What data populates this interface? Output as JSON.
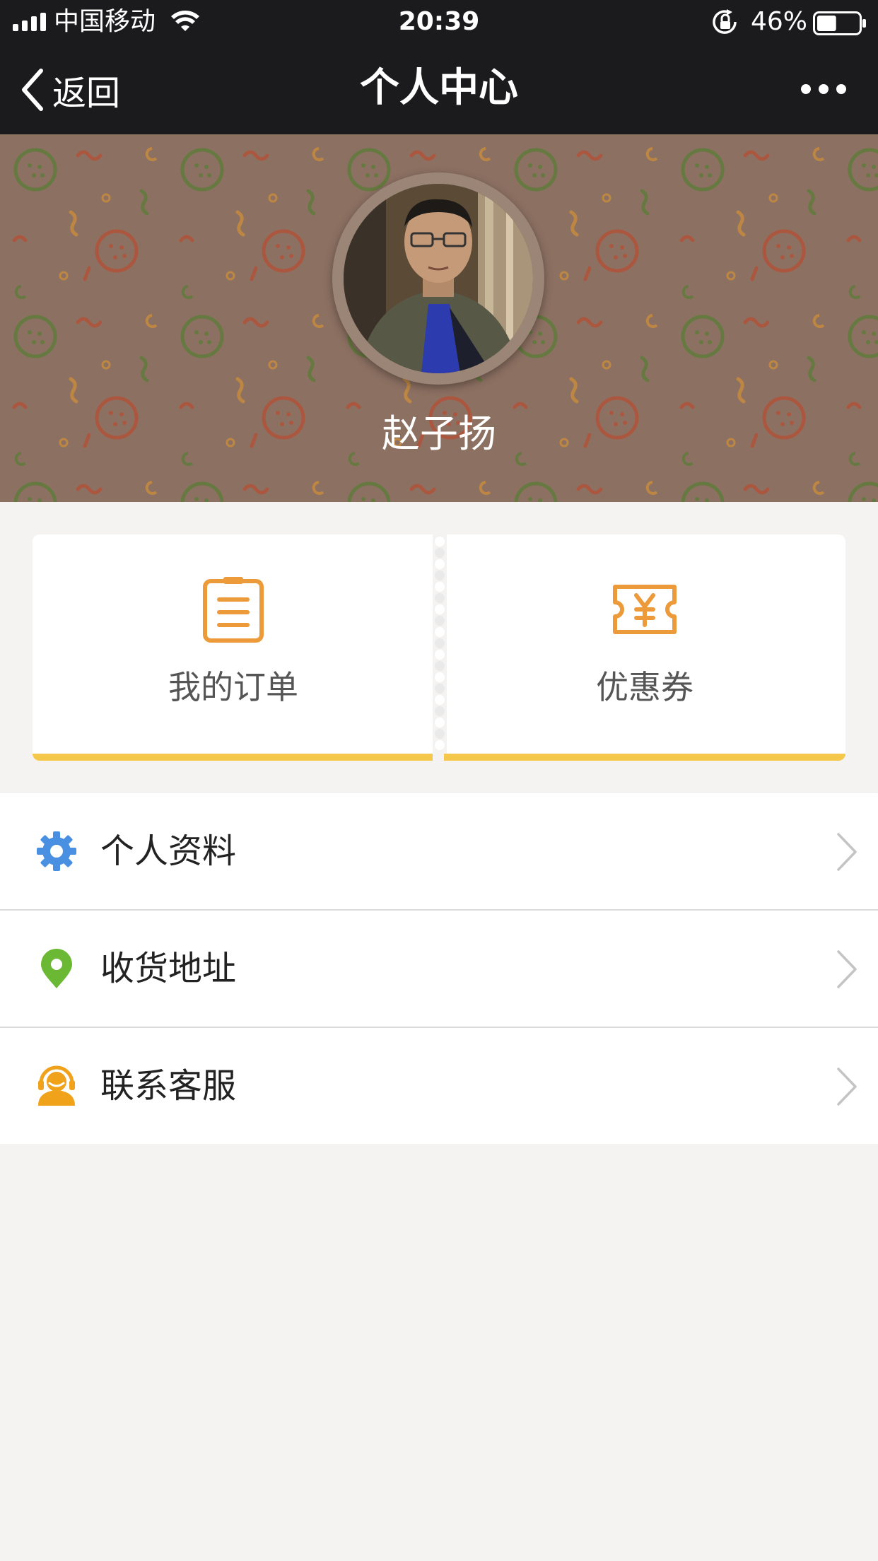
{
  "status_bar": {
    "carrier": "中国移动",
    "time": "20:39",
    "battery_percent": "46%",
    "battery_level": 0.46,
    "icons": [
      "signal-icon",
      "wifi-icon",
      "rotation-lock-icon",
      "battery-icon"
    ]
  },
  "nav": {
    "back_label": "返回",
    "title": "个人中心",
    "more_icon": "more-icon"
  },
  "profile": {
    "name": "赵子扬"
  },
  "quick_actions": [
    {
      "label": "我的订单",
      "icon": "order-clipboard-icon"
    },
    {
      "label": "优惠券",
      "icon": "coupon-icon"
    }
  ],
  "menu": [
    {
      "label": "个人资料",
      "icon": "gear-icon",
      "color": "#4a90e2"
    },
    {
      "label": "收货地址",
      "icon": "location-pin-icon",
      "color": "#6ab834"
    },
    {
      "label": "联系客服",
      "icon": "customer-service-icon",
      "color": "#f0a21b"
    }
  ],
  "colors": {
    "accent_orange": "#ec9a3a",
    "tab_underline": "#f5c84c",
    "nav_background": "#1b1b1d"
  }
}
